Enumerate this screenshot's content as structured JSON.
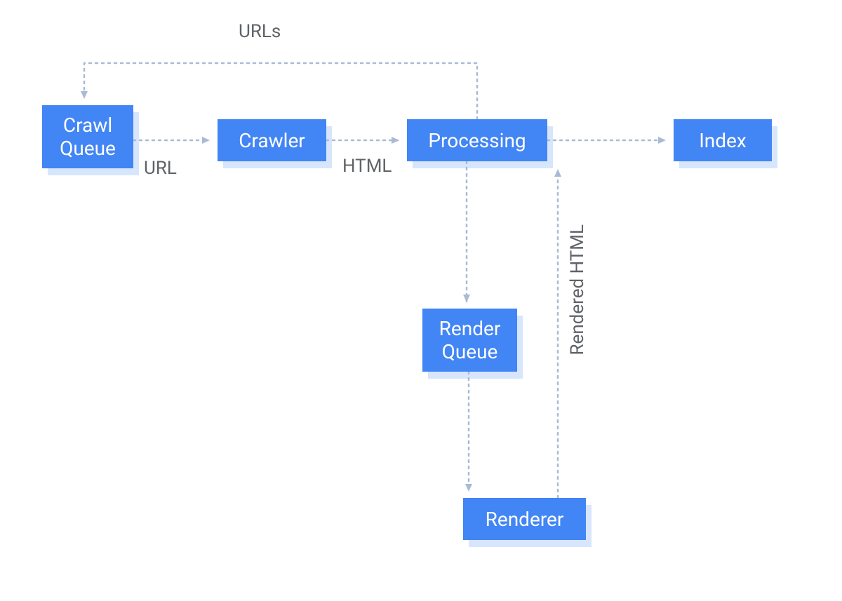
{
  "nodes": {
    "crawl_queue": "Crawl\nQueue",
    "crawler": "Crawler",
    "processing": "Processing",
    "index": "Index",
    "render_queue": "Render\nQueue",
    "renderer": "Renderer"
  },
  "edges": {
    "crawlqueue_to_crawler": "URL",
    "crawler_to_processing": "HTML",
    "processing_to_crawlqueue": "URLs",
    "renderer_to_processing": "Rendered HTML"
  },
  "colors": {
    "node_fill": "#4285f4",
    "node_shadow": "#d7e6fc",
    "connector": "#a8bbd5",
    "label_text": "#5f6368"
  }
}
